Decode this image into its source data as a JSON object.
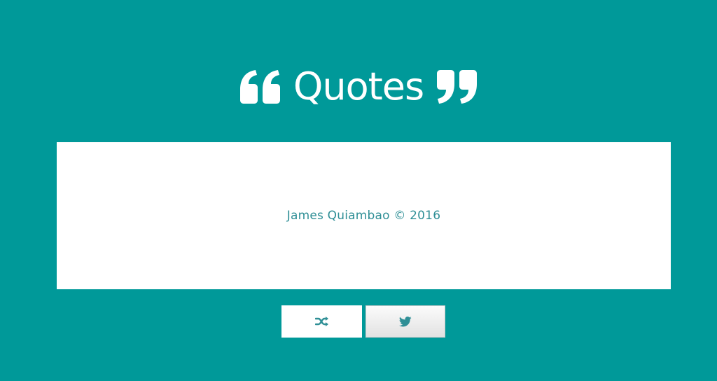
{
  "header": {
    "title": "Quotes",
    "open_icon": "quote-left-icon",
    "close_icon": "quote-right-icon"
  },
  "quote_card": {
    "footer": "James Quiambao © 2016"
  },
  "buttons": {
    "new_quote_icon": "shuffle-icon",
    "tweet_icon": "twitter-icon"
  },
  "colors": {
    "background": "#009999",
    "card": "#ffffff",
    "accent_text": "#2f8f96"
  }
}
